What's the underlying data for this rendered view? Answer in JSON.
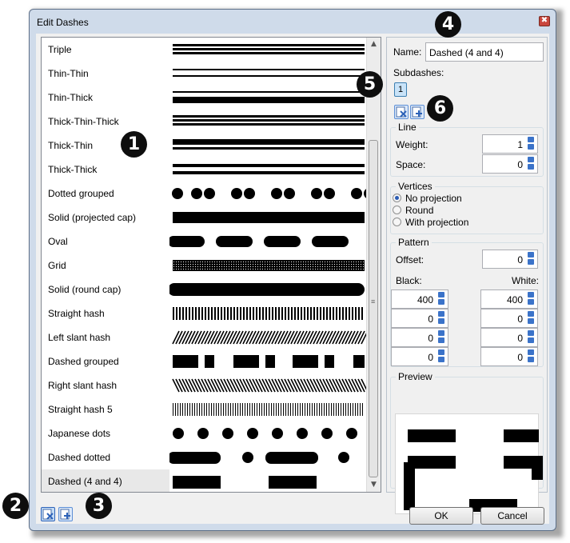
{
  "window": {
    "title": "Edit Dashes",
    "close_glyph": "✖"
  },
  "dash_list": [
    {
      "label": "Triple"
    },
    {
      "label": "Thin-Thin"
    },
    {
      "label": "Thin-Thick"
    },
    {
      "label": "Thick-Thin-Thick"
    },
    {
      "label": "Thick-Thin"
    },
    {
      "label": "Thick-Thick"
    },
    {
      "label": "Dotted grouped"
    },
    {
      "label": "Solid (projected cap)"
    },
    {
      "label": "Oval"
    },
    {
      "label": "Grid"
    },
    {
      "label": "Solid (round cap)"
    },
    {
      "label": "Straight hash"
    },
    {
      "label": "Left slant hash"
    },
    {
      "label": "Dashed grouped"
    },
    {
      "label": "Right slant hash"
    },
    {
      "label": "Straight hash 5"
    },
    {
      "label": "Japanese dots"
    },
    {
      "label": "Dashed dotted"
    },
    {
      "label": "Dashed (4 and 4)",
      "selected": true
    }
  ],
  "scrollbar": {
    "up": "▲",
    "down": "▼",
    "grip": "≡"
  },
  "editor": {
    "name_label": "Name:",
    "name_value": "Dashed (4 and 4)",
    "subdashes_label": "Subdashes:",
    "subdash_button": "1",
    "line_group": "Line",
    "weight_label": "Weight:",
    "weight_value": "1",
    "space_label": "Space:",
    "space_value": "0",
    "vertices_group": "Vertices",
    "vertices_options": [
      "No projection",
      "Round",
      "With projection"
    ],
    "vertices_selected": "No projection",
    "pattern_group": "Pattern",
    "offset_label": "Offset:",
    "offset_value": "0",
    "black_label": "Black:",
    "white_label": "White:",
    "black_values": [
      "400",
      "0",
      "0",
      "0"
    ],
    "white_values": [
      "400",
      "0",
      "0",
      "0"
    ],
    "preview_group": "Preview"
  },
  "buttons": {
    "ok": "OK",
    "cancel": "Cancel"
  },
  "callouts": {
    "c1": "1",
    "c2": "2",
    "c3": "3",
    "c4": "4",
    "c5": "5",
    "c6": "6"
  },
  "colors": {
    "accent": "#3b73c9",
    "frame": "#cfdbea",
    "selection": "#e8e8e8"
  }
}
